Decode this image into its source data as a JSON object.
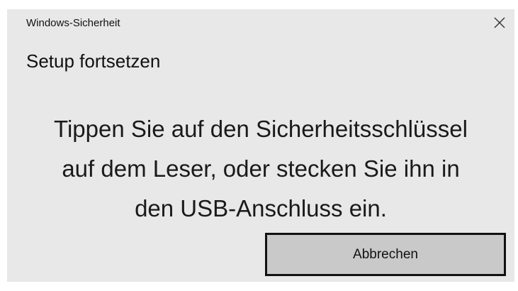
{
  "window": {
    "title": "Windows-Sicherheit",
    "close_icon": "close-icon"
  },
  "dialog": {
    "heading": "Setup fortsetzen",
    "message_lines": [
      "Tippen Sie auf den Sicherheitsschlüssel",
      "auf dem Leser, oder stecken Sie ihn in",
      "den USB-Anschluss ein."
    ],
    "cancel_label": "Abbrechen"
  },
  "colors": {
    "dialog_background": "#e8e8e8",
    "button_background": "#c9c9c9",
    "button_border": "#111111",
    "text": "#111111"
  }
}
